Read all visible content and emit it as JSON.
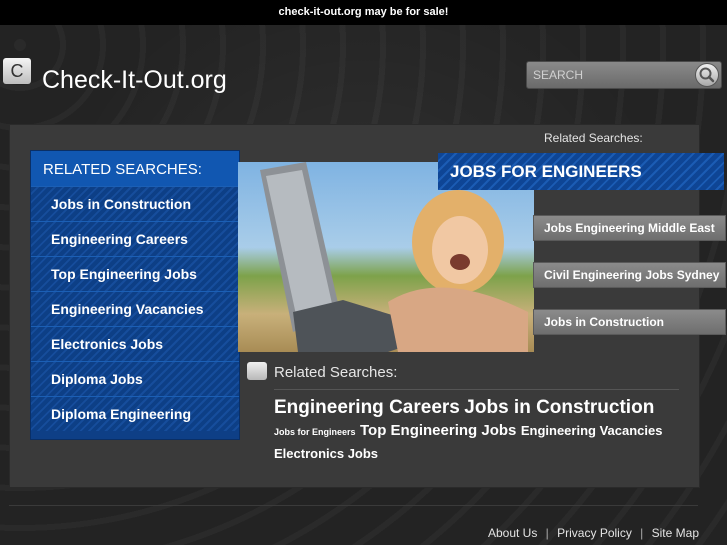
{
  "topbar": {
    "text": "check-it-out.org may be for sale!"
  },
  "header": {
    "logo_letter": "C",
    "site_title": "Check-It-Out.org"
  },
  "search": {
    "placeholder": "SEARCH",
    "icon": "search-icon"
  },
  "related_top": "Related Searches:",
  "left_box": {
    "heading": "RELATED SEARCHES:",
    "items": [
      "Jobs in Construction",
      "Engineering Careers",
      "Top Engineering Jobs",
      "Engineering Vacancies",
      "Electronics Jobs",
      "Diploma Jobs",
      "Diploma Engineering"
    ]
  },
  "jobs_box": {
    "heading": "JOBS FOR ENGINEERS",
    "items": [
      "Jobs Engineering Middle East",
      "Civil Engineering Jobs Sydney",
      "Jobs in Construction"
    ]
  },
  "related_section": {
    "label": "Related Searches:",
    "tags": [
      {
        "text": "Engineering Careers",
        "size": "lg"
      },
      {
        "text": "Jobs in Construction",
        "size": "lg"
      },
      {
        "text": "Jobs for Engineers",
        "size": "xs"
      },
      {
        "text": "Top Engineering Jobs",
        "size": "md"
      },
      {
        "text": "Engineering Vacancies",
        "size": "sm"
      },
      {
        "text": "Electronics Jobs",
        "size": "sm"
      }
    ]
  },
  "footer": {
    "about": "About Us",
    "privacy": "Privacy Policy",
    "sitemap": "Site Map",
    "separator": "|"
  },
  "colors": {
    "accent_blue": "#1157b1",
    "gray_button": "#7a7a7a",
    "panel": "#3a3a3a"
  }
}
